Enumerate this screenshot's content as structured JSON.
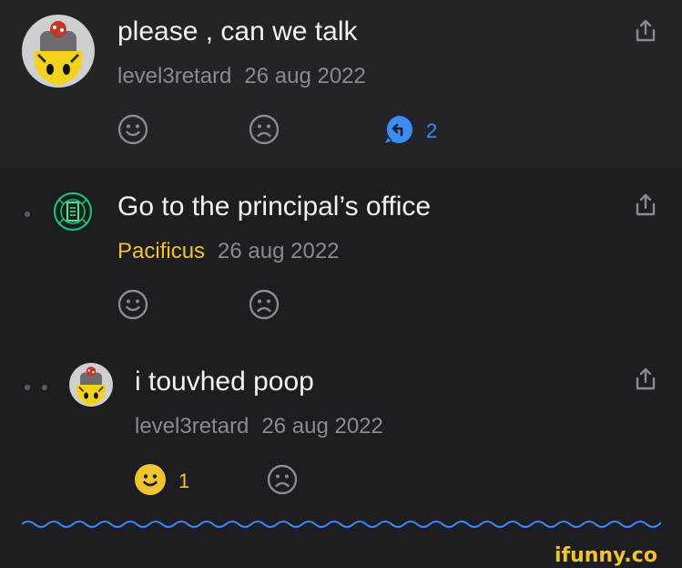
{
  "comments": [
    {
      "title": "please , can we talk",
      "author": "level3retard",
      "date": "26 aug 2022",
      "reply_count": "2"
    },
    {
      "title": "Go to the principal’s office",
      "author": "Pacificus",
      "date": "26 aug 2022"
    },
    {
      "title": "i touvhed poop",
      "author": "level3retard",
      "date": "26 aug 2022",
      "like_count": "1"
    }
  ],
  "icons": {
    "share": "share-icon",
    "like": "smile-icon",
    "dislike": "frown-icon",
    "reply": "reply-bubble-icon"
  },
  "colors": {
    "background": "#1e1e22",
    "highlight": "#242428",
    "accent_blue": "#3a8cf6",
    "accent_gold": "#f0c42c",
    "muted": "#8a8a90"
  },
  "watermark": {
    "text": "ifunny.co"
  }
}
